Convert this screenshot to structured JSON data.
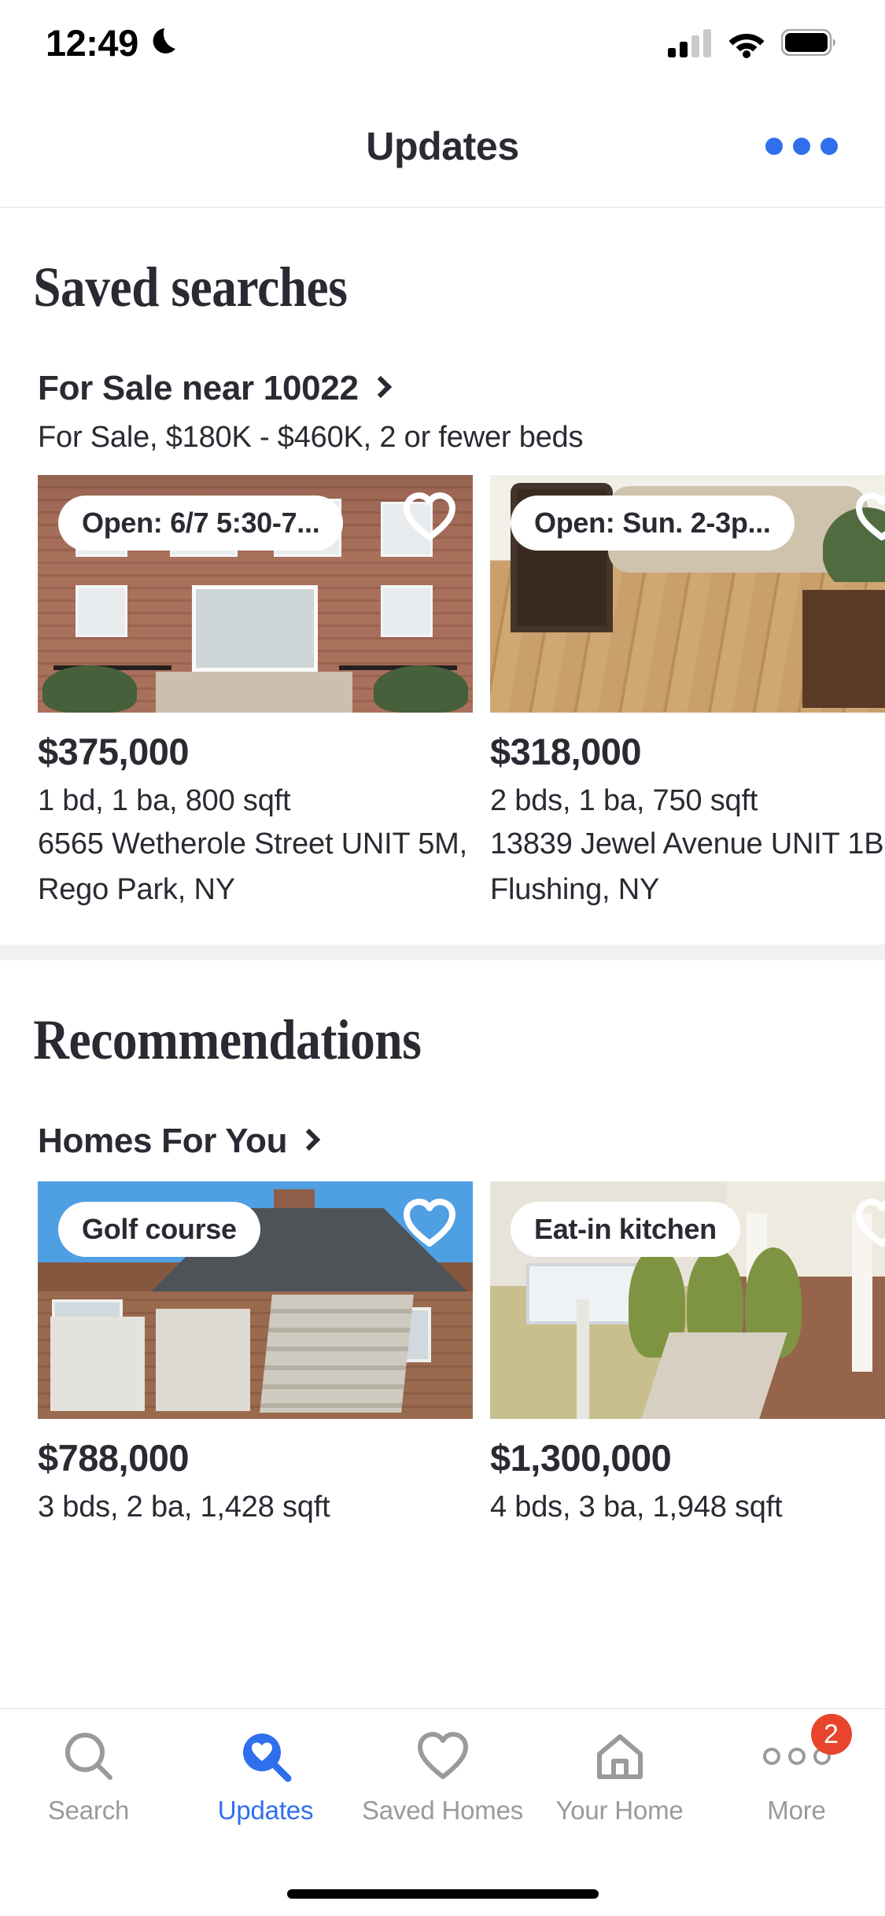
{
  "status_bar": {
    "time": "12:49",
    "dnd_icon": "moon-icon",
    "cellular_icon": "cellular-signal-icon",
    "cellular_bars_filled": 2,
    "cellular_bars_total": 4,
    "wifi_icon": "wifi-icon",
    "battery_icon": "battery-icon",
    "battery_level": 100
  },
  "header": {
    "title": "Updates",
    "more_icon": "more-horizontal-icon",
    "accent_color": "#2f6fed"
  },
  "saved_searches": {
    "heading": "Saved searches",
    "search": {
      "title": "For Sale near 10022",
      "chevron_icon": "chevron-right-icon",
      "criteria": "For Sale, $180K - $460K, 2 or fewer beds"
    },
    "listings": [
      {
        "badge": "Open: 6/7 5:30-7...",
        "favorite_icon": "heart-outline-icon",
        "price": "$375,000",
        "facts": "1 bd, 1 ba, 800 sqft",
        "address_line1": "6565 Wetherole Street UNIT 5M,",
        "address_line2": "Rego Park, NY"
      },
      {
        "badge": "Open: Sun. 2-3p...",
        "favorite_icon": "heart-outline-icon",
        "price": "$318,000",
        "facts": "2 bds, 1 ba, 750 sqft",
        "address_line1": "13839 Jewel Avenue UNIT 1B,",
        "address_line2": "Flushing, NY"
      }
    ]
  },
  "recommendations": {
    "heading": "Recommendations",
    "subsection": {
      "title": "Homes For You",
      "chevron_icon": "chevron-right-icon"
    },
    "listings": [
      {
        "badge": "Golf course",
        "favorite_icon": "heart-outline-icon",
        "price": "$788,000",
        "facts": "3 bds, 2 ba, 1,428 sqft"
      },
      {
        "badge": "Eat-in kitchen",
        "favorite_icon": "heart-outline-icon",
        "price": "$1,300,000",
        "facts": "4 bds, 3 ba, 1,948 sqft"
      }
    ]
  },
  "tab_bar": {
    "active_color": "#2f6fed",
    "inactive_color": "#9a9a9a",
    "badge_color": "#e8452c",
    "tabs": [
      {
        "label": "Search",
        "icon": "search-icon",
        "active": false
      },
      {
        "label": "Updates",
        "icon": "updates-heart-search-icon",
        "active": true
      },
      {
        "label": "Saved Homes",
        "icon": "heart-outline-icon",
        "active": false
      },
      {
        "label": "Your Home",
        "icon": "house-icon",
        "active": false
      },
      {
        "label": "More",
        "icon": "more-dots-icon",
        "active": false,
        "badge": "2"
      }
    ]
  }
}
